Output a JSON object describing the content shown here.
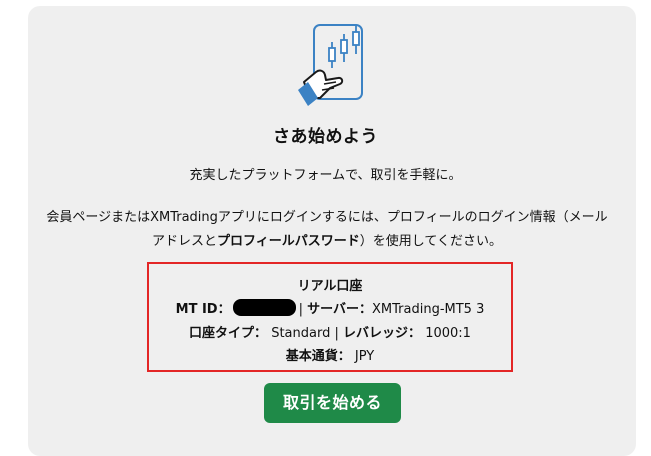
{
  "header": {
    "title": "さあ始めよう",
    "subtitle": "充実したプラットフォームで、取引を手軽に。"
  },
  "description": {
    "part1": "会員ページまたはXMTradingアプリにログインするには、プロフィールのログイン情報（メールアドレスと",
    "bold": "プロフィールパスワード",
    "part2": "）を使用してください。"
  },
  "account": {
    "heading": "リアル口座",
    "mt_id_label": "MT ID：",
    "separator": "|",
    "server_label": "サーバー：",
    "server_value": "XMTrading-MT5 3",
    "type_label": "口座タイプ：",
    "type_value": "Standard",
    "leverage_label": "レバレッジ：",
    "leverage_value": "1000:1",
    "currency_label": "基本通貨：",
    "currency_value": "JPY"
  },
  "actions": {
    "start_label": "取引を始める"
  },
  "colors": {
    "accent_green": "#1f8a48",
    "highlight_red": "#e32626",
    "icon_blue": "#3b82c4",
    "card_bg": "#efefef"
  },
  "icons": {
    "illustration": "hand-holding-phone-candlestick-icon"
  }
}
